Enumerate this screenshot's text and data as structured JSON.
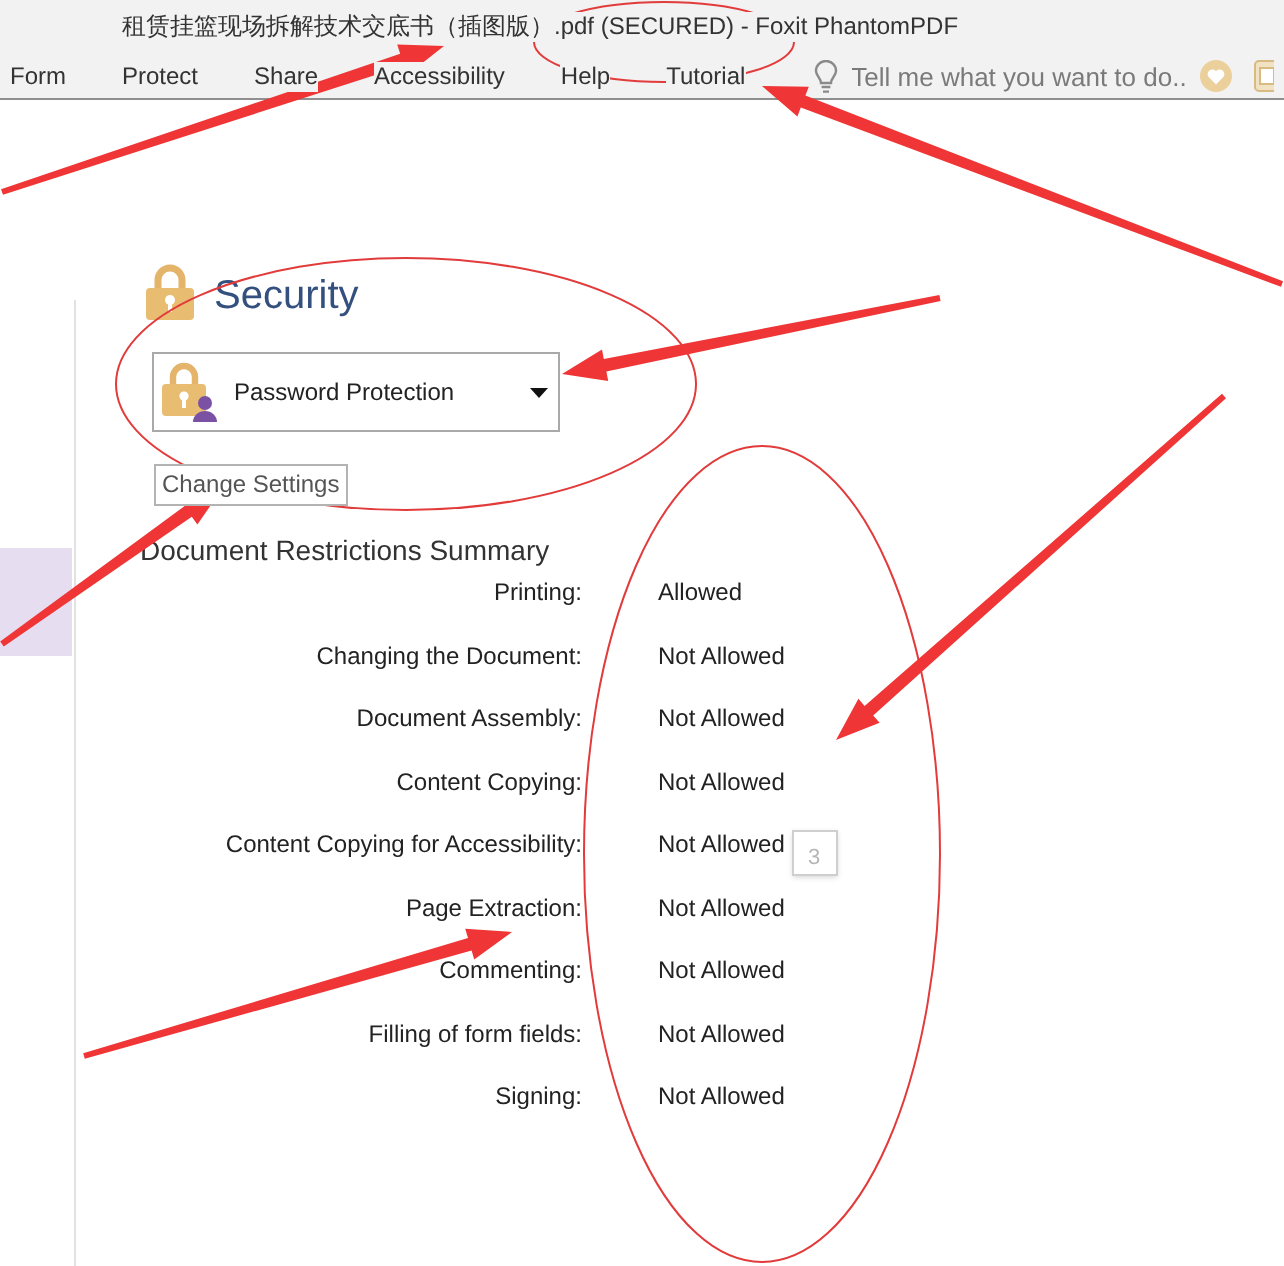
{
  "window": {
    "title": "租赁挂篮现场拆解技术交底书（插图版）.pdf (SECURED) - Foxit PhantomPDF"
  },
  "menu": {
    "tabs": [
      "Form",
      "Protect",
      "Share",
      "Accessibility",
      "Help",
      "Tutorial"
    ],
    "search": {
      "placeholder": "Tell me what you want to do.."
    }
  },
  "security_panel": {
    "heading": "Security",
    "method": "Password Protection",
    "change_button": "Change Settings",
    "summary_title": "Document Restrictions Summary",
    "restrictions": [
      {
        "label": "Printing:",
        "value": "Allowed"
      },
      {
        "label": "Changing the Document:",
        "value": "Not Allowed"
      },
      {
        "label": "Document Assembly:",
        "value": "Not Allowed"
      },
      {
        "label": "Content Copying:",
        "value": "Not Allowed"
      },
      {
        "label": "Content Copying for Accessibility:",
        "value": "Not Allowed"
      },
      {
        "label": "Page Extraction:",
        "value": "Not Allowed"
      },
      {
        "label": "Commenting:",
        "value": "Not Allowed"
      },
      {
        "label": "Filling of form fields:",
        "value": "Not Allowed"
      },
      {
        "label": "Signing:",
        "value": "Not Allowed"
      }
    ]
  },
  "page_tooltip": "3"
}
